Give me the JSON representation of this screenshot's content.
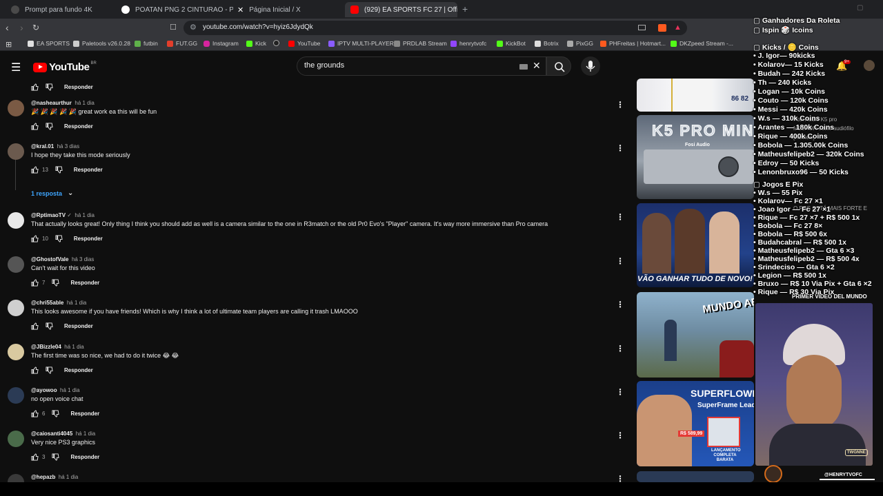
{
  "tabs": [
    {
      "title": "Prompt para fundo 4K",
      "color": "#4a4a4a"
    },
    {
      "title": "POATAN PNG 2 CINTURAO - Pesquisa",
      "color": "#ffffff"
    },
    {
      "title": "Página Inicial / X",
      "color": "#000000"
    },
    {
      "title": "(929) EA SPORTS FC 27 | Official",
      "color": "#ff0000"
    }
  ],
  "tab_close": "✕",
  "new_tab": "+",
  "address": {
    "url": "youtube.com/watch?v=hyiz6JdydQk"
  },
  "bookmarks": [
    {
      "label": "EA SPORTS",
      "color": "#e0e0e0"
    },
    {
      "label": "Paletools v26.0.28",
      "color": "#cccccc"
    },
    {
      "label": "futbin",
      "color": "#5fb04a"
    },
    {
      "label": "FUT.GG",
      "color": "#e33e2b"
    },
    {
      "label": "Instagram",
      "color": "#d6249f"
    },
    {
      "label": "Kick",
      "color": "#53fc18"
    },
    {
      "label": "",
      "color": "#222222"
    },
    {
      "label": "YouTube",
      "color": "#ff0000"
    },
    {
      "label": "IPTV MULTI-PLAYER",
      "color": "#8a5cff"
    },
    {
      "label": "PRDLAB Stream",
      "color": "#888888"
    },
    {
      "label": "henrytvofc",
      "color": "#9146ff"
    },
    {
      "label": "KickBot",
      "color": "#53fc18"
    },
    {
      "label": "Botrix",
      "color": "#dddddd"
    },
    {
      "label": "PixGG",
      "color": "#aaaaaa"
    },
    {
      "label": "PHFreitas | Hotmart...",
      "color": "#ff5a1f"
    },
    {
      "label": "DKZpeed Stream -...",
      "color": "#53fc18"
    }
  ],
  "youtube": {
    "logo": "YouTube",
    "region": "BR",
    "search_query": "the grounds"
  },
  "comments": [
    {
      "user": "",
      "time": "",
      "text": "",
      "likes": "",
      "reply": "Responder",
      "avatar": "#0f0f0f"
    },
    {
      "user": "@nasheaurthur",
      "time": "há 1 dia",
      "text": "🎉 🎉 🎉 🎉 🎉 great work ea this will be fun",
      "likes": "",
      "reply": "Responder",
      "avatar": "#7a5a44"
    },
    {
      "user": "@kral.01",
      "time": "há 3 dias",
      "text": "I hope they take this mode seriously",
      "likes": "13",
      "reply": "Responder",
      "avatar": "#6b5a4e"
    },
    {
      "user": "@RptimaoTV",
      "time": "há 1 dia",
      "verified": "✓",
      "text": "That actually looks great! Only thing I think you should add as well is a camera similar to the one in R3match or the old Pr0 Evo's \"Player\" camera. It's way more immersive than Pro camera",
      "likes": "10",
      "reply": "Responder",
      "avatar": "#e8e8e8"
    },
    {
      "user": "@GhostofVale",
      "time": "há 3 dias",
      "text": "Can't wait for this video",
      "likes": "7",
      "reply": "Responder",
      "avatar": "#555555"
    },
    {
      "user": "@chri55able",
      "time": "há 1 dia",
      "text": "This looks awesome if you have friends! Which is why I think a lot of ultimate team players are calling it trash LMAOOO",
      "likes": "",
      "reply": "Responder",
      "avatar": "#cfcfcf"
    },
    {
      "user": "@JBizzle04",
      "time": "há 1 dia",
      "text": "The first time was so nice, we had to do it twice 😂 😂",
      "likes": "",
      "reply": "Responder",
      "avatar": "#d9c9a0"
    },
    {
      "user": "@ayowoo",
      "time": "há 1 dia",
      "text": "no open voice chat",
      "likes": "6",
      "reply": "Responder",
      "avatar": "#2b3b55"
    },
    {
      "user": "@caiosanti4045",
      "time": "há 1 dia",
      "text": "Very nice PS3 graphics",
      "likes": "3",
      "reply": "Responder",
      "avatar": "#4a6b4a"
    },
    {
      "user": "@hepazb",
      "time": "há 1 dia",
      "text": "",
      "likes": "",
      "reply": "",
      "avatar": "#3a3a3a"
    }
  ],
  "replies_toggle": "1 resposta",
  "videos": [
    {
      "caption": "",
      "score": "86  82",
      "bg": "#c8ccd6",
      "accent": "#1a2b5c"
    },
    {
      "caption": "K5 PRO MINI",
      "sub": "Fosi Audio",
      "bg": "#7d8a99",
      "accent": "#3a4a5c"
    },
    {
      "caption": "VÃO GANHAR TUDO DE NOVO!",
      "bg": "#1c2f6b",
      "accent": "#b0223a"
    },
    {
      "caption": "MUNDO ABIERTO",
      "bg": "#5d7a92",
      "accent": "#c9a23a"
    },
    {
      "caption": "SUPERFLOWER V",
      "sub": "SuperFrame Leadex",
      "price": "R$ 589,99",
      "badge": "LANÇAMENTO COMPLETA BARATA",
      "bg": "#1b3f8a",
      "accent": "#e53935"
    }
  ],
  "video_meta": [
    {
      "text": "Fosi Audio K5 pro",
      "pos": "v1a"
    },
    {
      "text": "MELHOR custo audiófilo",
      "pos": "v1b"
    },
    {
      "text": "[Review]",
      "pos": "v1c"
    },
    {
      "text": "O PSG ESTÁ MAIS FORTE E",
      "pos": "v2a"
    },
    {
      "text": "PRIMER VIDEO DEL MUNDO",
      "pos": "v3a"
    }
  ],
  "overlay": {
    "title1": "Ganhadores Da Roleta",
    "title2": "Ispin 🎲 Icoins",
    "kicks_header": "Kicks / 🪙 Coins",
    "lines1": [
      "• J. Igor—  90kicks",
      "• Kolarov—  15 Kicks",
      "• Budah — 242 Kicks",
      "• Th — 240 Kicks",
      "• Logan — 10k Coins",
      "• Couto — 120k Coins",
      "• Messi — 420k Coins",
      "• W.s — 310k Coins",
      "• Arantes — 180k Coins",
      "• Rique — 400k Coins",
      "• Bobola — 1.305.00k Coins",
      "• Matheusfelipeb2  — 320k Coins",
      "•  Edroy — 50 Kicks",
      "•  Lenonbruxo96 — 50 Kicks"
    ],
    "jogos_header": "Jogos  E Pix",
    "lines2": [
      "• W.s — 55 Pix",
      "• Kolarov— Fc 27 ×1",
      "• Joao Igor — Fc 27 ×1",
      "• Rique — Fc 27 ×7 + R$ 500 1x",
      "• Bobola — Fc 27 8×",
      "• Bobola — R$ 500 6x",
      "• Budahcabral — R$ 500 1x",
      "• Matheusfelipeb2  — Gta 6 ×3",
      "• Matheusfelipeb2  —  R$ 500 4x",
      "• Srindeciso — Gta 6 ×2",
      "• Legion —  R$ 500 1x",
      "• Bruxo — R$ 10 Via Pix + Gta 6 ×2",
      "• Rique — R$ 30 Via Pix"
    ],
    "handle": "@HENRYTVOFC",
    "watermark": "TWGNNE"
  }
}
